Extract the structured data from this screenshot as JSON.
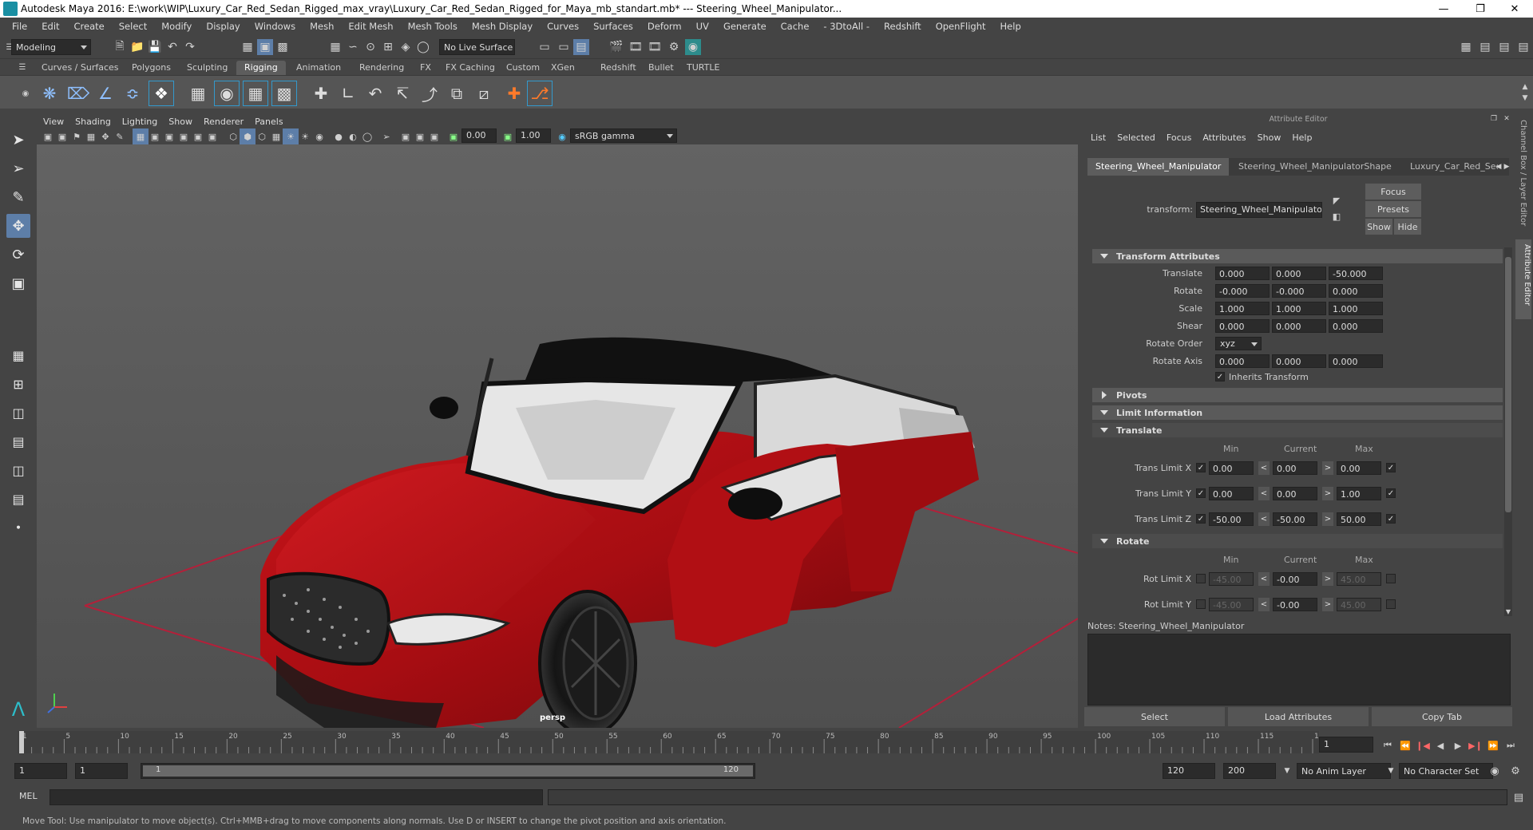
{
  "window": {
    "title": "Autodesk Maya 2016: E:\\work\\WIP\\Luxury_Car_Red_Sedan_Rigged_max_vray\\Luxury_Car_Red_Sedan_Rigged_for_Maya_mb_standart.mb*   ---   Steering_Wheel_Manipulator..."
  },
  "menubar": [
    "File",
    "Edit",
    "Create",
    "Select",
    "Modify",
    "Display",
    "Windows",
    "Mesh",
    "Edit Mesh",
    "Mesh Tools",
    "Mesh Display",
    "Curves",
    "Surfaces",
    "Deform",
    "UV",
    "Generate",
    "Cache",
    "- 3DtoAll -",
    "Redshift",
    "OpenFlight",
    "Help"
  ],
  "statusline": {
    "mode": "Modeling",
    "live_surface": "No Live Surface"
  },
  "shelf_tabs": [
    "Curves / Surfaces",
    "Polygons",
    "Sculpting",
    "Rigging",
    "Animation",
    "Rendering",
    "FX",
    "FX Caching",
    "Custom",
    "XGen",
    "Redshift",
    "Bullet",
    "TURTLE"
  ],
  "shelf_active": "Rigging",
  "viewport": {
    "menu": [
      "View",
      "Shading",
      "Lighting",
      "Show",
      "Renderer",
      "Panels"
    ],
    "exposure": "0.00",
    "gamma": "1.00",
    "color_space": "sRGB gamma",
    "camera_label": "persp"
  },
  "attribute_editor": {
    "header": "Attribute Editor",
    "menu": [
      "List",
      "Selected",
      "Focus",
      "Attributes",
      "Show",
      "Help"
    ],
    "tabs": [
      "Steering_Wheel_Manipulator",
      "Steering_Wheel_ManipulatorShape",
      "Luxury_Car_Red_Seda"
    ],
    "transform_label": "transform:",
    "transform_value": "Steering_Wheel_Manipulator",
    "focus_btn": "Focus",
    "presets_btn": "Presets",
    "show_btn": "Show",
    "hide_btn": "Hide",
    "transform_section": "Transform Attributes",
    "translate_label": "Translate",
    "translate": [
      "0.000",
      "0.000",
      "-50.000"
    ],
    "rotate_label": "Rotate",
    "rotate": [
      "-0.000",
      "-0.000",
      "0.000"
    ],
    "scale_label": "Scale",
    "scale": [
      "1.000",
      "1.000",
      "1.000"
    ],
    "shear_label": "Shear",
    "shear": [
      "0.000",
      "0.000",
      "0.000"
    ],
    "rotate_order_label": "Rotate Order",
    "rotate_order": "xyz",
    "rotate_axis_label": "Rotate Axis",
    "rotate_axis": [
      "0.000",
      "0.000",
      "0.000"
    ],
    "inherits_label": "Inherits Transform",
    "pivots_section": "Pivots",
    "limit_section": "Limit Information",
    "translate_sub": "Translate",
    "rotate_sub": "Rotate",
    "col_min": "Min",
    "col_current": "Current",
    "col_max": "Max",
    "trans_limits": [
      {
        "label": "Trans Limit X",
        "min": "0.00",
        "current": "0.00",
        "max": "0.00"
      },
      {
        "label": "Trans Limit Y",
        "min": "0.00",
        "current": "0.00",
        "max": "1.00"
      },
      {
        "label": "Trans Limit Z",
        "min": "-50.00",
        "current": "-50.00",
        "max": "50.00"
      }
    ],
    "rot_limits": [
      {
        "label": "Rot Limit X",
        "min": "-45.00",
        "current": "-0.00",
        "max": "45.00"
      },
      {
        "label": "Rot Limit Y",
        "min": "-45.00",
        "current": "-0.00",
        "max": "45.00"
      }
    ],
    "notes_label": "Notes:  Steering_Wheel_Manipulator",
    "select_btn": "Select",
    "load_btn": "Load Attributes",
    "copy_btn": "Copy Tab"
  },
  "side_tabs": [
    "Channel Box / Layer Editor",
    "Attribute Editor"
  ],
  "timeline": {
    "ticks": [
      "1",
      "5",
      "10",
      "15",
      "20",
      "25",
      "30",
      "35",
      "40",
      "45",
      "50",
      "55",
      "60",
      "65",
      "70",
      "75",
      "80",
      "85",
      "90",
      "95",
      "100",
      "105",
      "110",
      "115",
      "120"
    ],
    "current_frame": "1"
  },
  "range": {
    "start": "1",
    "start2": "1",
    "slider_start": "1",
    "slider_end": "120",
    "end": "120",
    "end2": "200",
    "anim_layer": "No Anim Layer",
    "char_set": "No Character Set"
  },
  "mel": {
    "label": "MEL"
  },
  "help_line": "Move Tool: Use manipulator to move object(s). Ctrl+MMB+drag to move components along normals. Use D or INSERT to change the pivot position and axis orientation."
}
